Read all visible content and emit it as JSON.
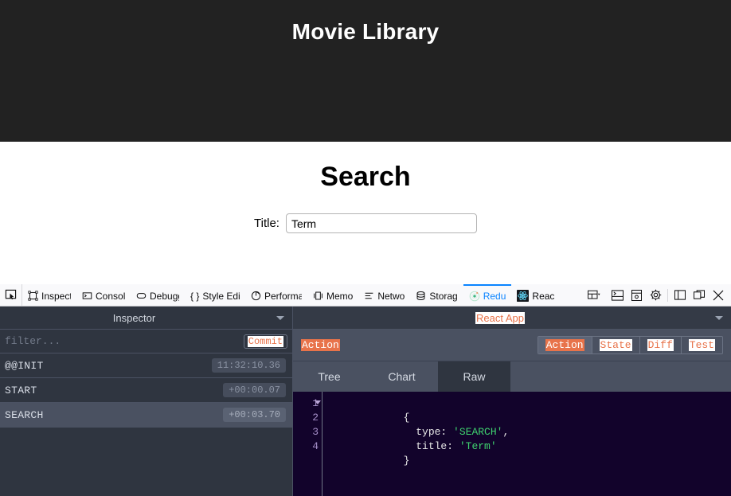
{
  "site": {
    "title": "Movie Library",
    "heading": "Search",
    "field_label": "Title:",
    "field_value": "Term",
    "field_placeholder": "",
    "header_bg": "#222222"
  },
  "devtools": {
    "picker_icon": "element-picker-icon",
    "tabs": [
      {
        "label": "Inspect",
        "icon": "inspector-icon",
        "active": false
      },
      {
        "label": "Consol",
        "icon": "console-icon",
        "active": false
      },
      {
        "label": "Debugg",
        "icon": "debugger-icon",
        "active": false
      },
      {
        "label": "Style Edit",
        "icon": "style-editor-icon",
        "active": false
      },
      {
        "label": "Performan",
        "icon": "performance-icon",
        "active": false
      },
      {
        "label": "Memo",
        "icon": "memory-icon",
        "active": false
      },
      {
        "label": "Netwo",
        "icon": "network-icon",
        "active": false
      },
      {
        "label": "Storag",
        "icon": "storage-icon",
        "active": false
      },
      {
        "label": "Redu",
        "icon": "redux-icon",
        "active": true
      },
      {
        "label": "Reac",
        "icon": "react-icon",
        "active": false
      }
    ],
    "right_buttons": [
      {
        "name": "responsive-design-mode-icon",
        "label": "Responsive Design Mode"
      },
      {
        "name": "split-console-icon",
        "label": "Split Console"
      },
      {
        "name": "screenshot-icon",
        "label": "Take Screenshot"
      },
      {
        "name": "settings-gear-icon",
        "label": "Settings"
      },
      {
        "name": "dock-side-icon",
        "label": "Dock to Side"
      },
      {
        "name": "separate-window-icon",
        "label": "Separate Window"
      },
      {
        "name": "close-icon",
        "label": "Close DevTools"
      }
    ],
    "active_tab_color": "#0a84ff"
  },
  "redux": {
    "left": {
      "selector_title": "Inspector",
      "filter_placeholder": "filter...",
      "commit_label": "Commit",
      "actions": [
        {
          "name": "@@INIT",
          "time": "11:32:10.36",
          "selected": false
        },
        {
          "name": "START",
          "time": "+00:00.07",
          "selected": false
        },
        {
          "name": "SEARCH",
          "time": "+00:03.70",
          "selected": true
        }
      ]
    },
    "right": {
      "instance_title": "React App",
      "mode_label": "Action",
      "mode_tabs": [
        {
          "label": "Action",
          "active": true
        },
        {
          "label": "State",
          "active": false
        },
        {
          "label": "Diff",
          "active": false
        },
        {
          "label": "Test",
          "active": false
        }
      ],
      "sub_tabs": [
        {
          "label": "Tree",
          "active": false
        },
        {
          "label": "Chart",
          "active": false
        },
        {
          "label": "Raw",
          "active": true
        }
      ],
      "code": {
        "line_numbers": [
          "1",
          "2",
          "3",
          "4"
        ],
        "lines": [
          {
            "segments": [
              {
                "t": "{",
                "c": "key"
              }
            ]
          },
          {
            "segments": [
              {
                "t": "  type: ",
                "c": "key"
              },
              {
                "t": "'SEARCH'",
                "c": "str"
              },
              {
                "t": ",",
                "c": "key"
              }
            ]
          },
          {
            "segments": [
              {
                "t": "  title: ",
                "c": "key"
              },
              {
                "t": "'Term'",
                "c": "str"
              }
            ]
          },
          {
            "segments": [
              {
                "t": "}",
                "c": "key"
              }
            ]
          }
        ]
      }
    },
    "accent": "#e8734a",
    "panel_bg": "#343a46"
  }
}
